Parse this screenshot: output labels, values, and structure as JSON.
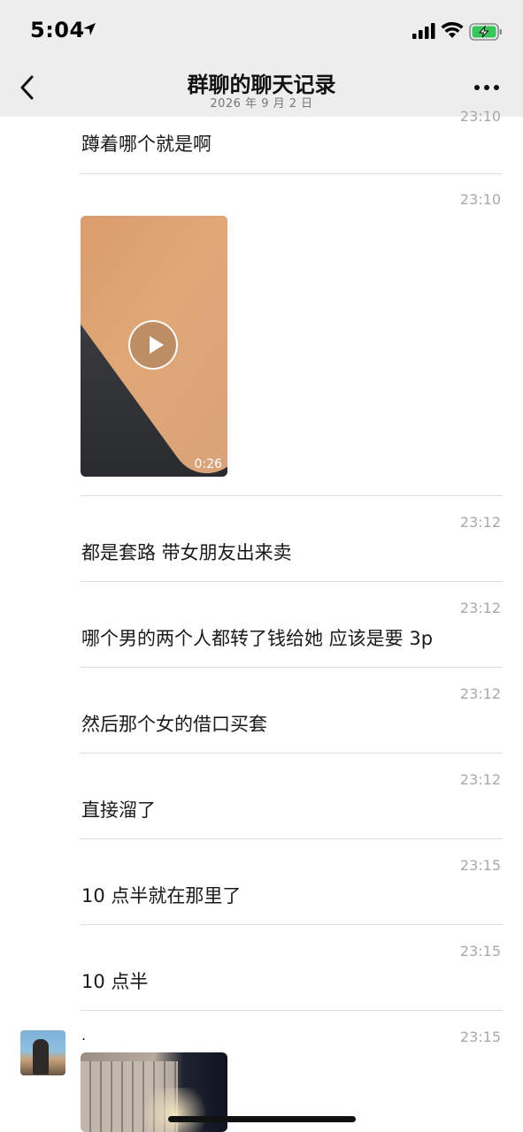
{
  "status_bar": {
    "time": "5:04"
  },
  "nav": {
    "title": "群聊的聊天记录",
    "subtitle": "2026 年 9 月 2 日"
  },
  "messages": [
    {
      "time": "23:10",
      "text": "蹲着哪个就是啊"
    },
    {
      "time": "23:10",
      "type": "video",
      "duration": "0:26"
    },
    {
      "time": "23:12",
      "text": "都是套路 带女朋友出来卖"
    },
    {
      "time": "23:12",
      "text": "哪个男的两个人都转了钱给她 应该是要 3p"
    },
    {
      "time": "23:12",
      "text": "然后那个女的借口买套"
    },
    {
      "time": "23:12",
      "text": "直接溜了"
    },
    {
      "time": "23:15",
      "text": "10 点半就在那里了"
    },
    {
      "time": "23:15",
      "text": "10 点半"
    },
    {
      "time": "23:15",
      "text": ".",
      "type": "video"
    }
  ],
  "icons": {
    "back": "chevron-left-icon",
    "more": "more-dots-icon",
    "play": "play-icon",
    "location": "location-arrow-icon",
    "signal": "signal-icon",
    "wifi": "wifi-icon",
    "battery": "battery-charging-icon"
  },
  "colors": {
    "nav_bg": "#ededed",
    "timestamp": "#a9a9a9",
    "battery_fill": "#35c759"
  }
}
